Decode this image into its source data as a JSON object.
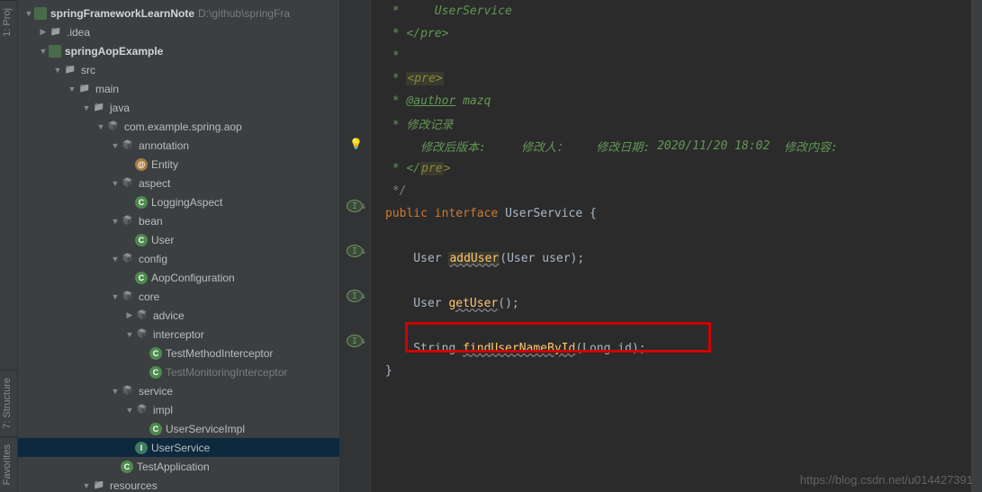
{
  "sideTabs": {
    "project": "1: Proj",
    "structure": "7: Structure",
    "favorites": "Favorites"
  },
  "tree": [
    {
      "indent": 0,
      "arrow": "expanded",
      "icon": "module",
      "label": "springFrameworkLearnNote",
      "bold": true,
      "path": "D:\\github\\springFra"
    },
    {
      "indent": 1,
      "arrow": "collapsed",
      "icon": "folder",
      "label": ".idea"
    },
    {
      "indent": 1,
      "arrow": "expanded",
      "icon": "module",
      "label": "springAopExample",
      "bold": true
    },
    {
      "indent": 2,
      "arrow": "expanded",
      "icon": "folder",
      "label": "src"
    },
    {
      "indent": 3,
      "arrow": "expanded",
      "icon": "folder",
      "label": "main"
    },
    {
      "indent": 4,
      "arrow": "expanded",
      "icon": "folder",
      "label": "java"
    },
    {
      "indent": 5,
      "arrow": "expanded",
      "icon": "pkg",
      "label": "com.example.spring.aop"
    },
    {
      "indent": 6,
      "arrow": "expanded",
      "icon": "pkg",
      "label": "annotation"
    },
    {
      "indent": 7,
      "arrow": "none",
      "icon": "anno",
      "iconChar": "@",
      "label": "Entity"
    },
    {
      "indent": 6,
      "arrow": "expanded",
      "icon": "pkg",
      "label": "aspect"
    },
    {
      "indent": 7,
      "arrow": "none",
      "icon": "class",
      "iconChar": "C",
      "label": "LoggingAspect"
    },
    {
      "indent": 6,
      "arrow": "expanded",
      "icon": "pkg",
      "label": "bean"
    },
    {
      "indent": 7,
      "arrow": "none",
      "icon": "class",
      "iconChar": "C",
      "label": "User"
    },
    {
      "indent": 6,
      "arrow": "expanded",
      "icon": "pkg",
      "label": "config"
    },
    {
      "indent": 7,
      "arrow": "none",
      "icon": "class",
      "iconChar": "C",
      "label": "AopConfiguration"
    },
    {
      "indent": 6,
      "arrow": "expanded",
      "icon": "pkg",
      "label": "core"
    },
    {
      "indent": 7,
      "arrow": "collapsed",
      "icon": "pkg",
      "label": "advice"
    },
    {
      "indent": 7,
      "arrow": "expanded",
      "icon": "pkg",
      "label": "interceptor"
    },
    {
      "indent": 8,
      "arrow": "none",
      "icon": "class",
      "iconChar": "C",
      "label": "TestMethodInterceptor"
    },
    {
      "indent": 8,
      "arrow": "none",
      "icon": "class",
      "iconChar": "C",
      "label": "TestMonitoringInterceptor",
      "greyed": true
    },
    {
      "indent": 6,
      "arrow": "expanded",
      "icon": "pkg",
      "label": "service"
    },
    {
      "indent": 7,
      "arrow": "expanded",
      "icon": "pkg",
      "label": "impl"
    },
    {
      "indent": 8,
      "arrow": "none",
      "icon": "class",
      "iconChar": "C",
      "label": "UserServiceImpl"
    },
    {
      "indent": 7,
      "arrow": "none",
      "icon": "interface",
      "iconChar": "I",
      "label": "UserService",
      "selected": true
    },
    {
      "indent": 6,
      "arrow": "none",
      "icon": "class",
      "iconChar": "C",
      "label": "TestApplication"
    },
    {
      "indent": 4,
      "arrow": "expanded",
      "icon": "folder",
      "label": "resources"
    }
  ],
  "code": {
    "l0": " *     UserService",
    "l1": " * </pre>",
    "l2": " *",
    "l3a": " * ",
    "l3b": "<pre>",
    "l4a": " * ",
    "l4b": "@author",
    "l4c": " mazq",
    "l5": " * 修改记录",
    "l6a": "     修改后版本:     修改人：    修改日期: ",
    "l6b": "2020/11/20 18:02",
    "l6c": "  修改内容:",
    "l7a": " * </",
    "l7b": "pre",
    "l7c": ">",
    "l8": " */",
    "l9a": "public",
    "l9b": " interface ",
    "l9c": "UserService ",
    "l9d": "{",
    "l11a": "    User ",
    "l11b": "addUser",
    "l11c": "(User user)",
    "l11d": ";",
    "l13a": "    User ",
    "l13b": "getUser",
    "l13c": "()",
    "l13d": ";",
    "l15a": "    String ",
    "l15b": "findUserNameById",
    "l15c": "(Long id)",
    "l15d": ";",
    "l16": "}"
  },
  "gutterMarks": {
    "m1": "I",
    "m2": "I",
    "m3": "I",
    "m4": "I"
  },
  "watermark": "https://blog.csdn.net/u014427391"
}
